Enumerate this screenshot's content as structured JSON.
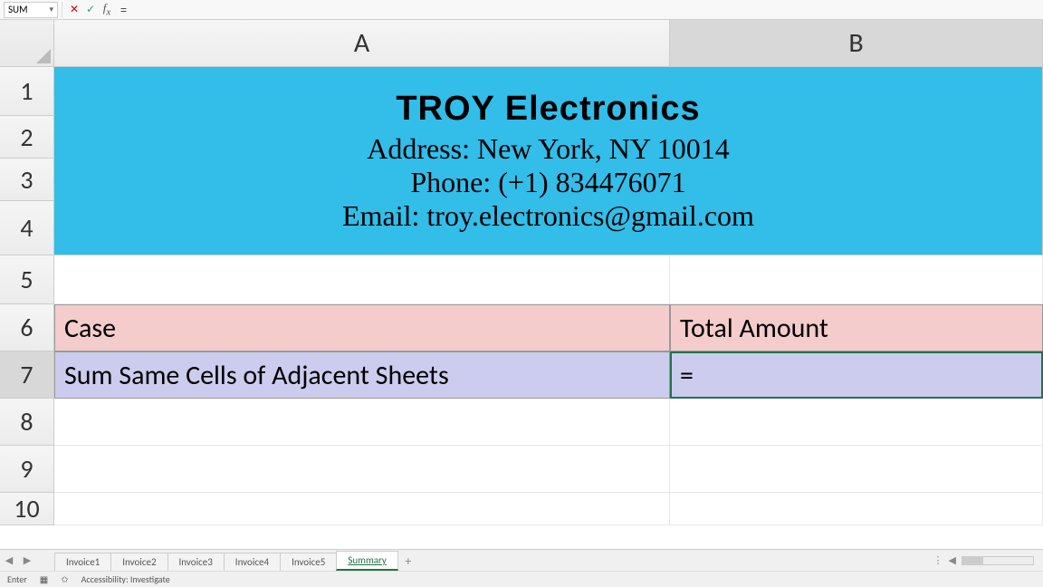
{
  "formula_bar": {
    "name_box": "SUM",
    "formula": "="
  },
  "columns": [
    "A",
    "B"
  ],
  "row_numbers": [
    "1",
    "2",
    "3",
    "4",
    "5",
    "6",
    "7",
    "8",
    "9",
    "10"
  ],
  "header_block": {
    "title": "TROY Electronics",
    "address": "Address: New York, NY 10014",
    "phone": "Phone: (+1) 834476071",
    "email": "Email: troy.electronics@gmail.com"
  },
  "table": {
    "header_a": "Case",
    "header_b": "Total Amount",
    "data_a": "Sum Same Cells of Adjacent Sheets",
    "data_b": "="
  },
  "tabs": [
    "Invoice1",
    "Invoice2",
    "Invoice3",
    "Invoice4",
    "Invoice5",
    "Summary"
  ],
  "active_tab": "Summary",
  "status": {
    "mode": "Enter",
    "accessibility": "Accessibility: Investigate"
  }
}
